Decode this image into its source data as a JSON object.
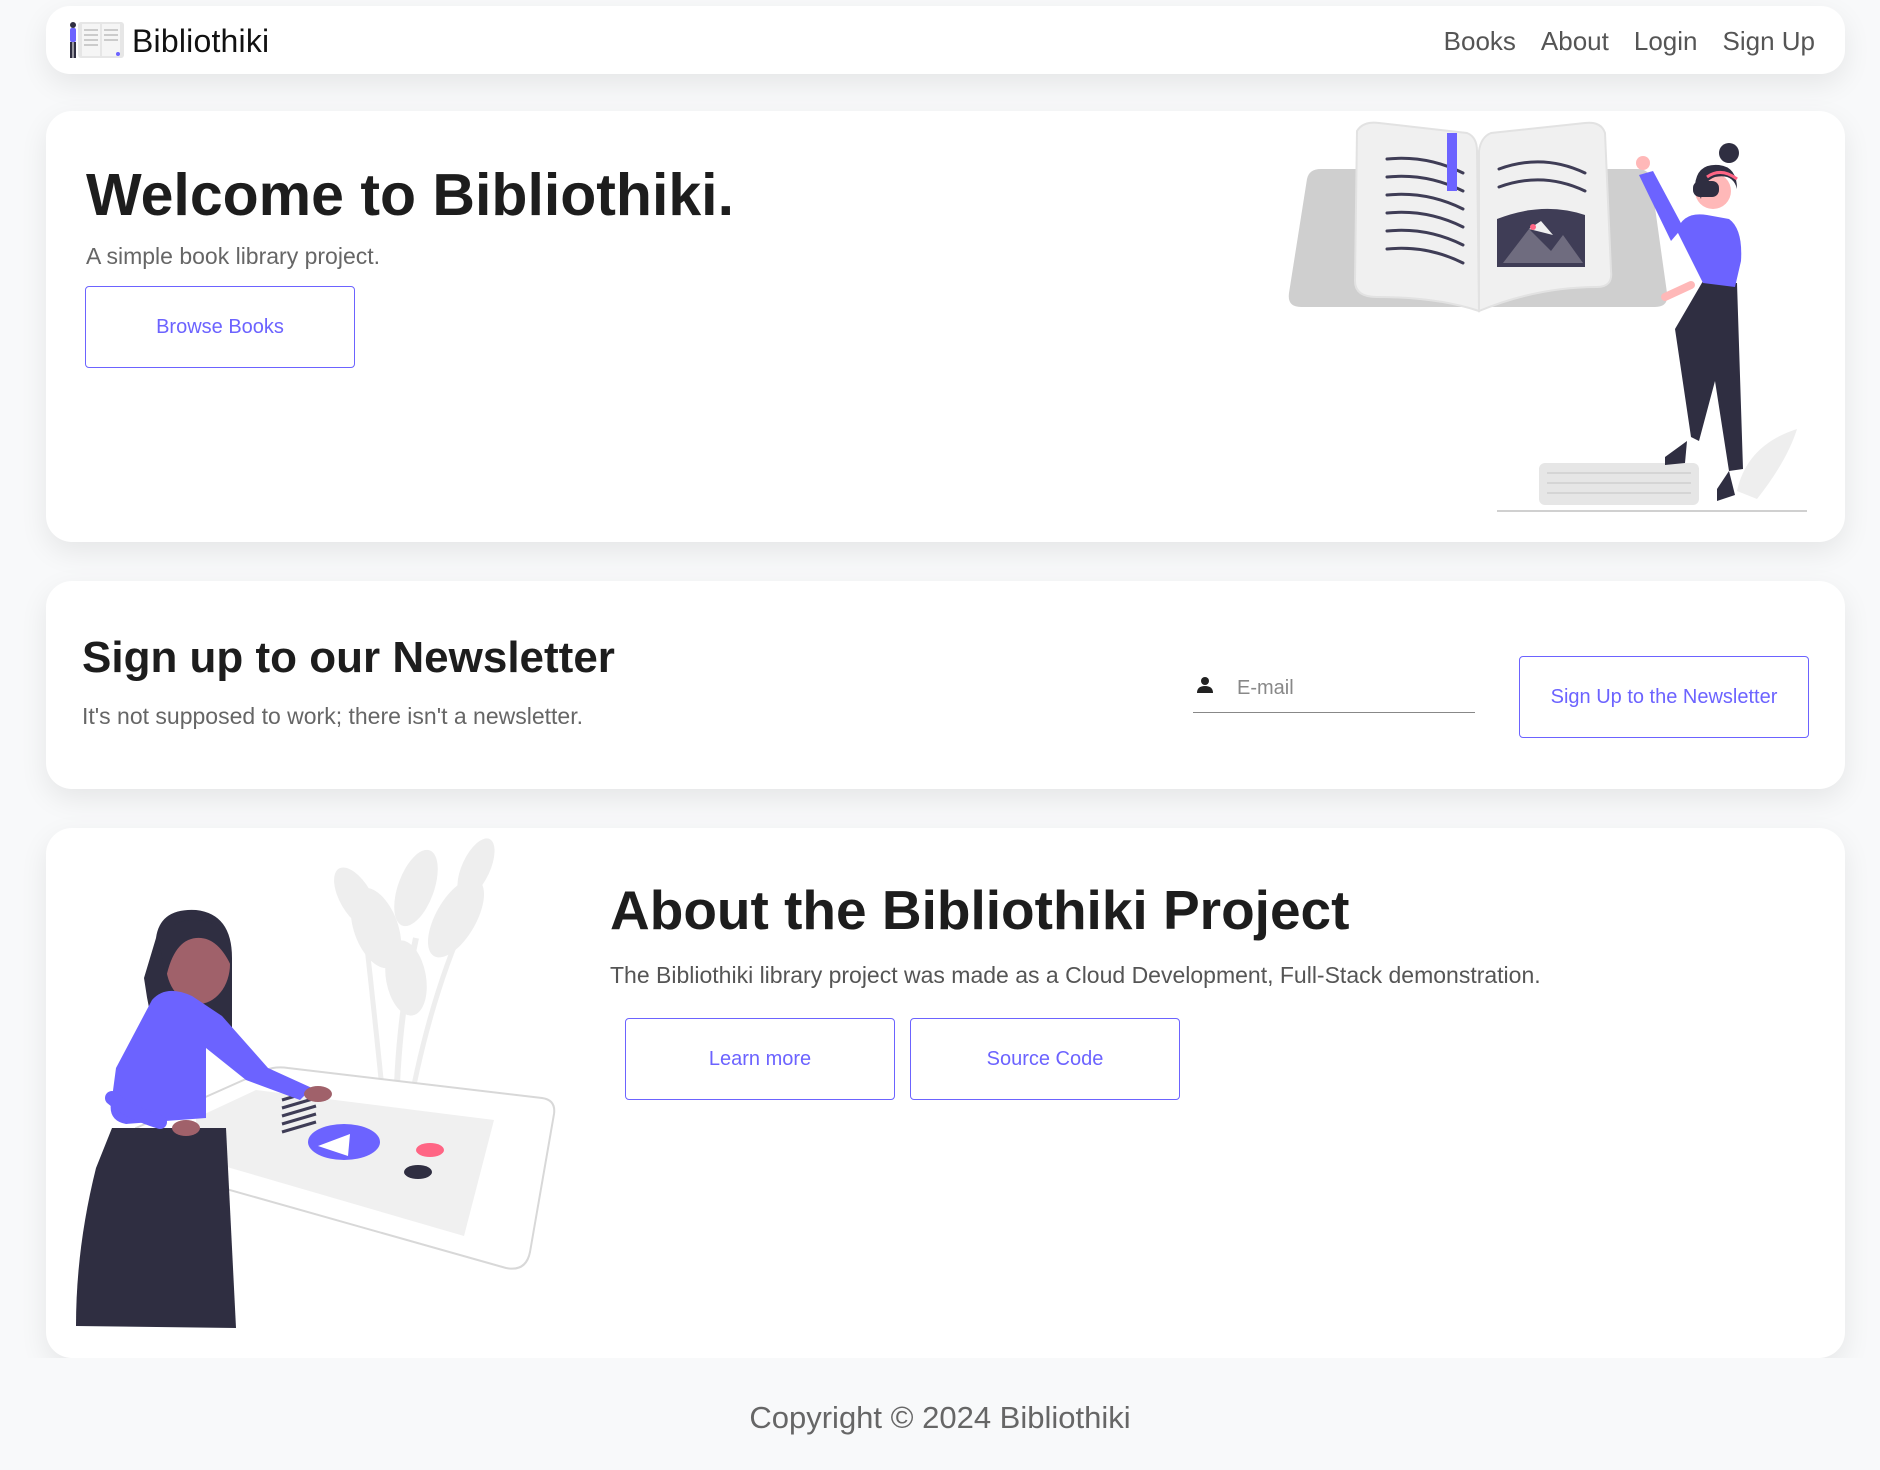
{
  "navbar": {
    "brand": "Bibliothiki",
    "links": [
      "Books",
      "About",
      "Login",
      "Sign Up"
    ]
  },
  "hero": {
    "title": "Welcome to Bibliothiki.",
    "subtitle": "A simple book library project.",
    "button_label": "Browse Books"
  },
  "newsletter": {
    "title": "Sign up to our Newsletter",
    "subtitle": "It's not supposed to work; there isn't a newsletter.",
    "email_placeholder": "E-mail",
    "email_value": "",
    "button_label": "Sign Up to the Newsletter"
  },
  "about": {
    "title": "About the Bibliothiki Project",
    "subtitle": "The Bibliothiki library project was made as a Cloud Development, Full-Stack demonstration.",
    "learn_more_label": "Learn more",
    "source_code_label": "Source Code"
  },
  "footer": {
    "copyright": "Copyright © 2024 Bibliothiki"
  },
  "colors": {
    "accent": "#6c63ff",
    "dark": "#2f2e41",
    "skin": "#ffb8b8",
    "skin_dark": "#a0616a",
    "pink": "#ff6584",
    "background": "#f8f9fa"
  },
  "icons": {
    "brand": "book-reader-logo-icon",
    "email_field": "user-icon"
  }
}
